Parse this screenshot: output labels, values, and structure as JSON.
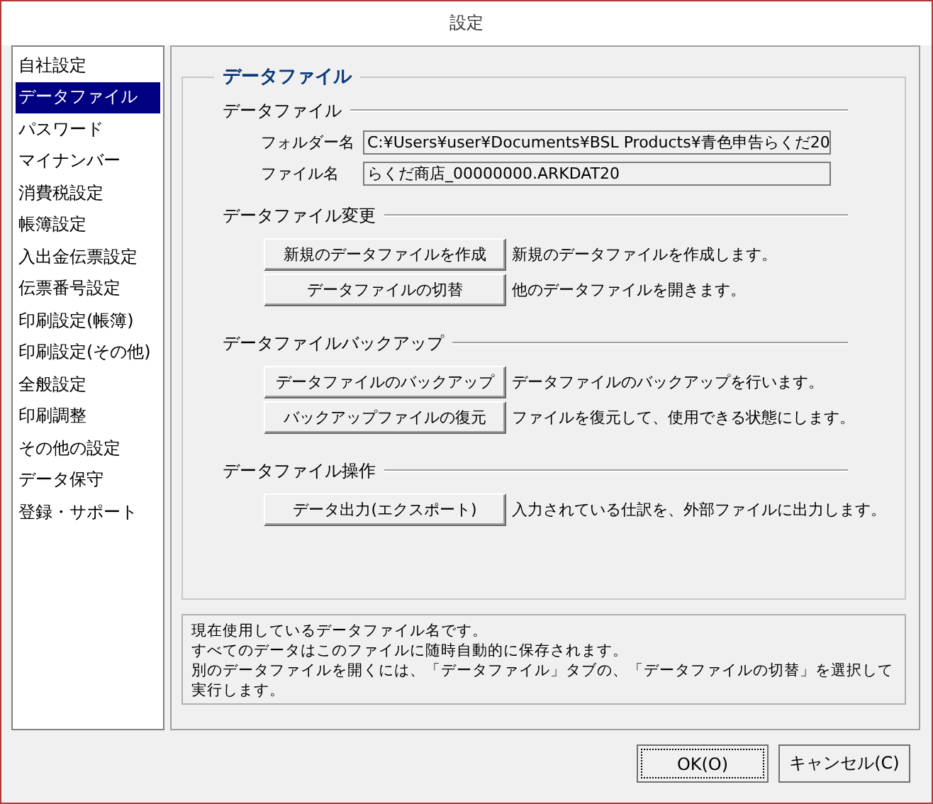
{
  "window": {
    "title": "設定"
  },
  "sidebar": {
    "items": [
      {
        "label": "自社設定",
        "selected": false
      },
      {
        "label": "データファイル",
        "selected": true
      },
      {
        "label": "パスワード",
        "selected": false
      },
      {
        "label": "マイナンバー",
        "selected": false
      },
      {
        "label": "消費税設定",
        "selected": false
      },
      {
        "label": "帳簿設定",
        "selected": false
      },
      {
        "label": "入出金伝票設定",
        "selected": false
      },
      {
        "label": "伝票番号設定",
        "selected": false
      },
      {
        "label": "印刷設定(帳簿)",
        "selected": false
      },
      {
        "label": "印刷設定(その他)",
        "selected": false
      },
      {
        "label": "全般設定",
        "selected": false
      },
      {
        "label": "印刷調整",
        "selected": false
      },
      {
        "label": "その他の設定",
        "selected": false
      },
      {
        "label": "データ保守",
        "selected": false
      },
      {
        "label": "登録・サポート",
        "selected": false
      }
    ]
  },
  "panel": {
    "title": "データファイル",
    "sections": [
      {
        "title": "データファイル",
        "kind": "fields",
        "fields": [
          {
            "label": "フォルダー名",
            "value": "C:¥Users¥user¥Documents¥BSL Products¥青色申告らくだ20"
          },
          {
            "label": "ファイル名",
            "value": "らくだ商店_00000000.ARKDAT20"
          }
        ]
      },
      {
        "title": "データファイル変更",
        "kind": "actions",
        "actions": [
          {
            "button": "新規のデータファイルを作成",
            "description": "新規のデータファイルを作成します。"
          },
          {
            "button": "データファイルの切替",
            "description": "他のデータファイルを開きます。"
          }
        ]
      },
      {
        "title": "データファイルバックアップ",
        "kind": "actions",
        "actions": [
          {
            "button": "データファイルのバックアップ",
            "description": "データファイルのバックアップを行います。"
          },
          {
            "button": "バックアップファイルの復元",
            "description": "ファイルを復元して、使用できる状態にします。"
          }
        ]
      },
      {
        "title": "データファイル操作",
        "kind": "actions",
        "actions": [
          {
            "button": "データ出力(エクスポート)",
            "description": "入力されている仕訳を、外部ファイルに出力します。"
          }
        ]
      }
    ]
  },
  "help_lines": [
    "現在使用しているデータファイル名です。",
    "すべてのデータはこのファイルに随時自動的に保存されます。",
    "別のデータファイルを開くには、「データファイル」タブの、「データファイルの切替」を選択して",
    "実行します。"
  ],
  "buttons": [
    {
      "label": "OK(O)",
      "focused": true
    },
    {
      "label": "キャンセル(C)",
      "focused": false
    }
  ]
}
